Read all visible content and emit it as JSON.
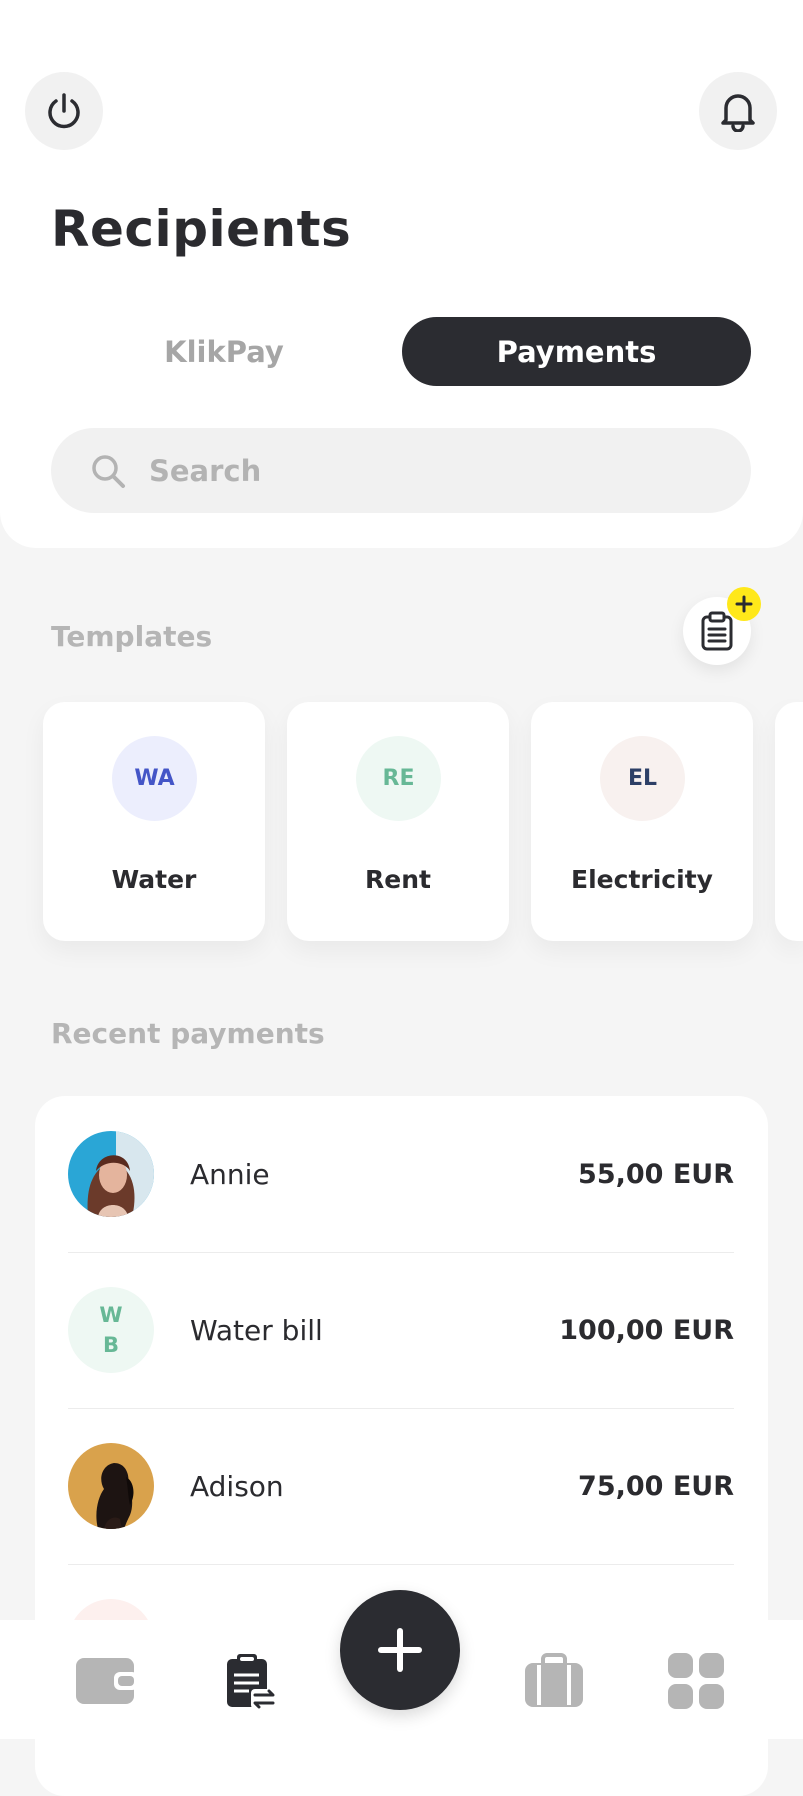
{
  "header": {
    "title": "Recipients"
  },
  "tabs": [
    {
      "label": "KlikPay",
      "active": false
    },
    {
      "label": "Payments",
      "active": true
    }
  ],
  "search": {
    "placeholder": "Search"
  },
  "templates": {
    "title": "Templates",
    "items": [
      {
        "initials": "WA",
        "label": "Water",
        "color": "#4455c7",
        "bg": "#eceefd"
      },
      {
        "initials": "RE",
        "label": "Rent",
        "color": "#67b896",
        "bg": "#eef8f3"
      },
      {
        "initials": "EL",
        "label": "Electricity",
        "color": "#2d3f66",
        "bg": "#f8f1ef"
      }
    ]
  },
  "recent_payments": {
    "title": "Recent payments",
    "items": [
      {
        "name": "Annie",
        "amount": "55,00 EUR",
        "avatar": "photo"
      },
      {
        "initials_line1": "W",
        "initials_line2": "B",
        "name": "Water bill",
        "amount": "100,00 EUR",
        "avatar": "initials"
      },
      {
        "name": "Adison",
        "amount": "75,00 EUR",
        "avatar": "photo"
      }
    ]
  },
  "nav": {
    "items": [
      "wallet-icon",
      "payments-icon",
      "add-icon",
      "briefcase-icon",
      "grid-icon"
    ]
  },
  "colors": {
    "dark": "#2b2c31",
    "accent_yellow": "#ffe81a",
    "muted_text": "#b5b5b5"
  }
}
